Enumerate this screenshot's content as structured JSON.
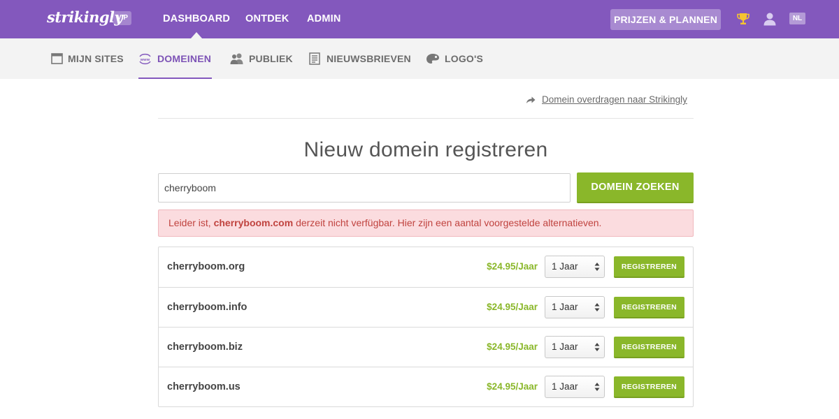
{
  "header": {
    "logo": "strikingly",
    "badge": "VIP",
    "nav": [
      "DASHBOARD",
      "ONTDEK",
      "ADMIN"
    ],
    "pricing_label": "PRIJZEN & PLANNEN",
    "lang": "NL"
  },
  "subnav": {
    "items": [
      {
        "label": "MIJN SITES",
        "icon": "browser-window-icon"
      },
      {
        "label": "DOMEINEN",
        "icon": "www-icon"
      },
      {
        "label": "PUBLIEK",
        "icon": "people-icon"
      },
      {
        "label": "NIEUWSBRIEVEN",
        "icon": "newsletter-icon"
      },
      {
        "label": "LOGO'S",
        "icon": "palette-icon"
      }
    ]
  },
  "transfer_link": "Domein overdragen naar Strikingly",
  "page_title": "Nieuw domein registreren",
  "search": {
    "value": "cherryboom",
    "button_label": "DOMEIN ZOEKEN"
  },
  "alert": {
    "prefix": "Leider ist, ",
    "domain": "cherryboom.com",
    "suffix": " derzeit nicht verfügbar. Hier zijn een aantal voorgestelde alternatieven."
  },
  "results": [
    {
      "domain": "cherryboom.org",
      "price": "$24.95/Jaar",
      "term": "1 Jaar",
      "button": "REGISTREREN"
    },
    {
      "domain": "cherryboom.info",
      "price": "$24.95/Jaar",
      "term": "1 Jaar",
      "button": "REGISTREREN"
    },
    {
      "domain": "cherryboom.biz",
      "price": "$24.95/Jaar",
      "term": "1 Jaar",
      "button": "REGISTREREN"
    },
    {
      "domain": "cherryboom.us",
      "price": "$24.95/Jaar",
      "term": "1 Jaar",
      "button": "REGISTREREN"
    }
  ],
  "colors": {
    "brand": "#8358bd",
    "accent_green": "#8ab72a",
    "alert_bg": "#fbdcdf",
    "alert_text": "#c0433f"
  }
}
